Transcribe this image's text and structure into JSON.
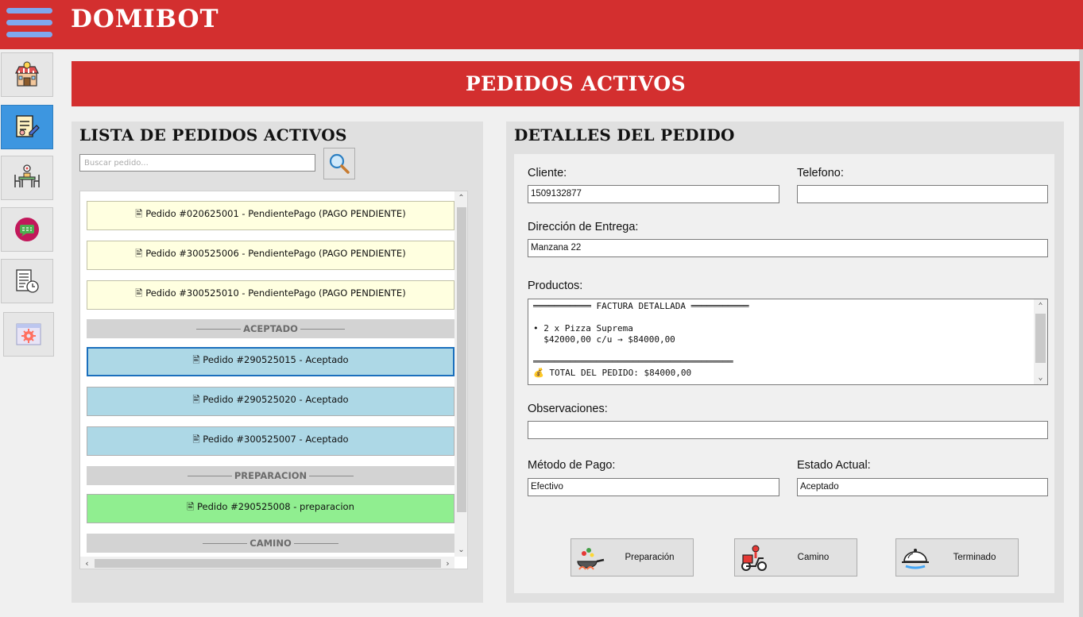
{
  "app": {
    "title": "DOMIBOT"
  },
  "page": {
    "banner": "PEDIDOS ACTIVOS"
  },
  "sidebar": {
    "items": [
      {
        "icon": "store-icon"
      },
      {
        "icon": "order-edit-icon",
        "active": true
      },
      {
        "icon": "dining-table-icon"
      },
      {
        "icon": "chat-bubble-icon"
      },
      {
        "icon": "report-history-icon"
      },
      {
        "icon": "settings-window-icon"
      }
    ]
  },
  "list_panel": {
    "title": "LISTA DE PEDIDOS ACTIVOS",
    "search_placeholder": "Buscar pedido...",
    "orders": [
      {
        "label": "🖹 Pedido #020625001 - PendientePago (PAGO PENDIENTE)",
        "status": "pending"
      },
      {
        "label": "🖹 Pedido #300525006 - PendientePago (PAGO PENDIENTE)",
        "status": "pending"
      },
      {
        "label": "🖹 Pedido #300525010 - PendientePago (PAGO PENDIENTE)",
        "status": "pending"
      },
      {
        "group": "ACEPTADO"
      },
      {
        "label": "🖹 Pedido #290525015 - Aceptado",
        "status": "accepted",
        "selected": true
      },
      {
        "label": "🖹 Pedido #290525020 - Aceptado",
        "status": "accepted"
      },
      {
        "label": "🖹 Pedido #300525007 - Aceptado",
        "status": "accepted"
      },
      {
        "group": "PREPARACION"
      },
      {
        "label": "🖹 Pedido #290525008 - preparacion",
        "status": "prep"
      },
      {
        "group": "CAMINO"
      }
    ]
  },
  "detail_panel": {
    "title": "DETALLES DEL PEDIDO",
    "cliente_label": "Cliente:",
    "cliente_value": "1509132877",
    "telefono_label": "Telefono:",
    "telefono_value": "",
    "direccion_label": "Dirección de Entrega:",
    "direccion_value": "Manzana 22",
    "productos_label": "Productos:",
    "productos_lines": [
      "═══════════ FACTURA DETALLADA ═══════════",
      "",
      "• 2 x Pizza Suprema",
      "  $42000,00 c/u → $84000,00",
      "",
      "══════════════════════════════════════",
      "💰 TOTAL DEL PEDIDO: $84000,00"
    ],
    "observaciones_label": "Observaciones:",
    "observaciones_value": "",
    "metodo_label": "Método de Pago:",
    "metodo_value": "Efectivo",
    "estado_label": "Estado Actual:",
    "estado_value": "Aceptado"
  },
  "actions": [
    {
      "label": "Preparación",
      "icon": "cooking-pan-icon"
    },
    {
      "label": "Camino",
      "icon": "delivery-scooter-icon"
    },
    {
      "label": "Terminado",
      "icon": "serving-cloche-icon"
    }
  ],
  "colors": {
    "brand_red": "#d32f2f",
    "pending": "#ffffe0",
    "accepted": "#add8e6",
    "prep": "#90ee90",
    "sidebar_active": "#3d96e0"
  }
}
